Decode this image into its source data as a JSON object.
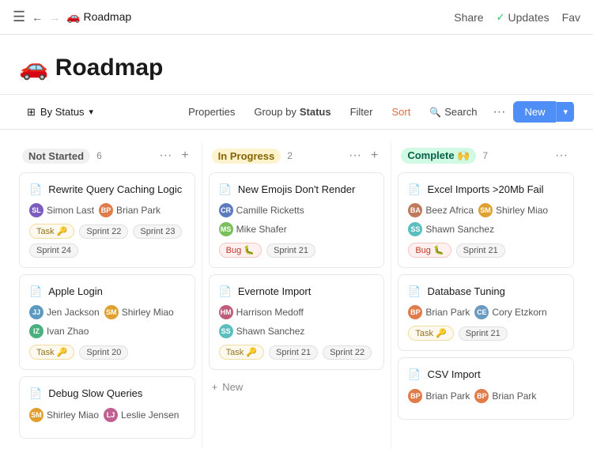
{
  "topnav": {
    "breadcrumb": "🚗 Roadmap",
    "share": "Share",
    "updates": "Updates",
    "fav": "Fav"
  },
  "page": {
    "title": "🚗 Roadmap"
  },
  "toolbar": {
    "view_label": "By Status",
    "properties": "Properties",
    "group_by_prefix": "Group by ",
    "group_by_value": "Status",
    "filter": "Filter",
    "sort": "Sort",
    "search": "Search",
    "more": "···",
    "new": "New"
  },
  "columns": [
    {
      "id": "not-started",
      "title": "Not Started",
      "count": 6,
      "cards": [
        {
          "title": "Rewrite Query Caching Logic",
          "assignees": [
            "Simon Last",
            "Brian Park"
          ],
          "avatarColors": [
            "#7c5cbf",
            "#e07c4a"
          ],
          "tag": "Task 🔑",
          "tagType": "task",
          "sprints": [
            "Sprint 22",
            "Sprint 23",
            "Sprint 24"
          ]
        },
        {
          "title": "Apple Login",
          "assignees": [
            "Jen Jackson",
            "Shirley Miao",
            "Ivan Zhao"
          ],
          "avatarColors": [
            "#5c9abf",
            "#e0a030",
            "#4caf80"
          ],
          "tag": "Task 🔑",
          "tagType": "task",
          "sprints": [
            "Sprint 20"
          ]
        },
        {
          "title": "Debug Slow Queries",
          "assignees": [
            "Shirley Miao",
            "Leslie Jensen"
          ],
          "avatarColors": [
            "#e0a030",
            "#c06090"
          ],
          "tag": null,
          "sprints": []
        }
      ]
    },
    {
      "id": "in-progress",
      "title": "In Progress",
      "count": 2,
      "cards": [
        {
          "title": "New Emojis Don't Render",
          "assignees": [
            "Camille Ricketts",
            "Mike Shafer"
          ],
          "avatarColors": [
            "#5c7abf",
            "#7abf5c"
          ],
          "tag": "Bug 🐛",
          "tagType": "bug",
          "sprints": [
            "Sprint 21"
          ]
        },
        {
          "title": "Evernote Import",
          "assignees": [
            "Harrison Medoff",
            "Shawn Sanchez"
          ],
          "avatarColors": [
            "#bf5c7a",
            "#5cbfbf"
          ],
          "tag": "Task 🔑",
          "tagType": "task",
          "sprints": [
            "Sprint 21",
            "Sprint 22"
          ]
        }
      ],
      "addNew": true
    },
    {
      "id": "complete",
      "title": "Complete 🙌",
      "count": 7,
      "cards": [
        {
          "title": "Excel Imports >20Mb Fail",
          "assignees": [
            "Beez Africa",
            "Shirley Miao",
            "Shawn Sanchez"
          ],
          "avatarColors": [
            "#bf7a5c",
            "#e0a030",
            "#5cbfbf"
          ],
          "tag": "Bug 🐛",
          "tagType": "bug",
          "sprints": [
            "Sprint 21"
          ]
        },
        {
          "title": "Database Tuning",
          "assignees": [
            "Brian Park",
            "Cory Etzkorn"
          ],
          "avatarColors": [
            "#e07c4a",
            "#6a9abf"
          ],
          "tag": "Task 🔑",
          "tagType": "task",
          "sprints": [
            "Sprint 21"
          ]
        },
        {
          "title": "CSV Import",
          "assignees": [
            "Brian Park",
            "Brian Park"
          ],
          "avatarColors": [
            "#e07c4a",
            "#e07c4a"
          ],
          "tag": null,
          "sprints": []
        }
      ]
    }
  ],
  "icons": {
    "menu": "☰",
    "back": "←",
    "forward": "→",
    "checkmark": "✓",
    "caret_down": "▾",
    "more": "···",
    "plus": "+",
    "doc": "📄",
    "search": "🔍"
  }
}
